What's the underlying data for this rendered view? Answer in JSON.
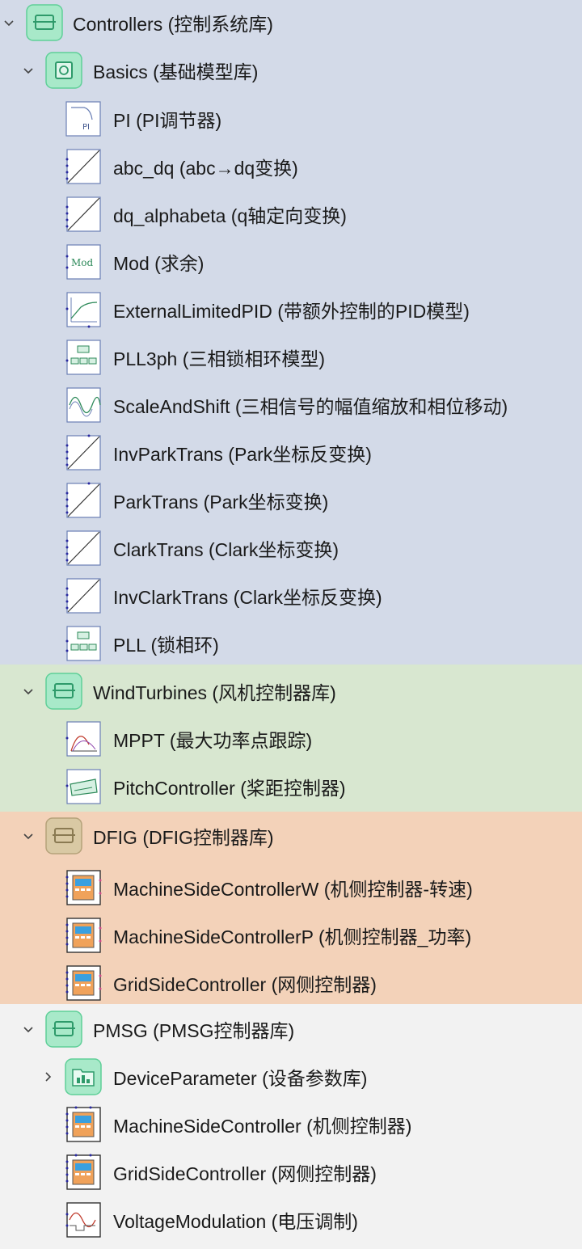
{
  "tree": {
    "controllers": {
      "label": "Controllers (控制系统库)",
      "basics": {
        "label": "Basics (基础模型库)",
        "items": [
          {
            "label": "PI (PI调节器)",
            "icon": "pi-block-icon"
          },
          {
            "label": "abc_dq (abc→dq变换)",
            "icon": "transform-block-icon"
          },
          {
            "label": "dq_alphabeta (q轴定向变换)",
            "icon": "transform-block-icon"
          },
          {
            "label": "Mod (求余)",
            "icon": "mod-block-icon"
          },
          {
            "label": "ExternalLimitedPID (带额外控制的PID模型)",
            "icon": "pid-curve-block-icon"
          },
          {
            "label": "PLL3ph (三相锁相环模型)",
            "icon": "pll-block-icon"
          },
          {
            "label": "ScaleAndShift (三相信号的幅值缩放和相位移动)",
            "icon": "sine-block-icon"
          },
          {
            "label": "InvParkTrans (Park坐标反变换)",
            "icon": "transform-block-icon"
          },
          {
            "label": "ParkTrans (Park坐标变换)",
            "icon": "transform-block-icon"
          },
          {
            "label": "ClarkTrans (Clark坐标变换)",
            "icon": "transform-block-icon"
          },
          {
            "label": "InvClarkTrans (Clark坐标反变换)",
            "icon": "transform-block-icon"
          },
          {
            "label": "PLL (锁相环)",
            "icon": "pll-block-icon"
          }
        ]
      }
    },
    "wind": {
      "label": "WindTurbines (风机控制器库)",
      "items": [
        {
          "label": "MPPT (最大功率点跟踪)",
          "icon": "mppt-curve-icon"
        },
        {
          "label": "PitchController (桨距控制器)",
          "icon": "pitch-controller-icon"
        }
      ]
    },
    "dfig": {
      "label": "DFIG (DFIG控制器库)",
      "items": [
        {
          "label": "MachineSideControllerW (机侧控制器-转速)",
          "icon": "controller-block-icon"
        },
        {
          "label": "MachineSideControllerP (机侧控制器_功率)",
          "icon": "controller-block-icon"
        },
        {
          "label": "GridSideController (网侧控制器)",
          "icon": "controller-block-icon"
        }
      ]
    },
    "pmsg": {
      "label": "PMSG (PMSG控制器库)",
      "items": [
        {
          "label": "DeviceParameter (设备参数库)",
          "icon": "parameter-record-icon",
          "collapsed": true
        },
        {
          "label": "MachineSideController (机侧控制器)",
          "icon": "controller-block-icon"
        },
        {
          "label": "GridSideController (网侧控制器)",
          "icon": "controller-block-icon"
        },
        {
          "label": "VoltageModulation (电压调制)",
          "icon": "modulation-block-icon"
        }
      ]
    }
  },
  "colors": {
    "controllers_bg": "#d3dae8",
    "wind_bg": "#d8e7d0",
    "dfig_bg": "#f3d2b9",
    "pmsg_bg": "#f2f2f2",
    "package_icon": "#6fd7a6"
  }
}
